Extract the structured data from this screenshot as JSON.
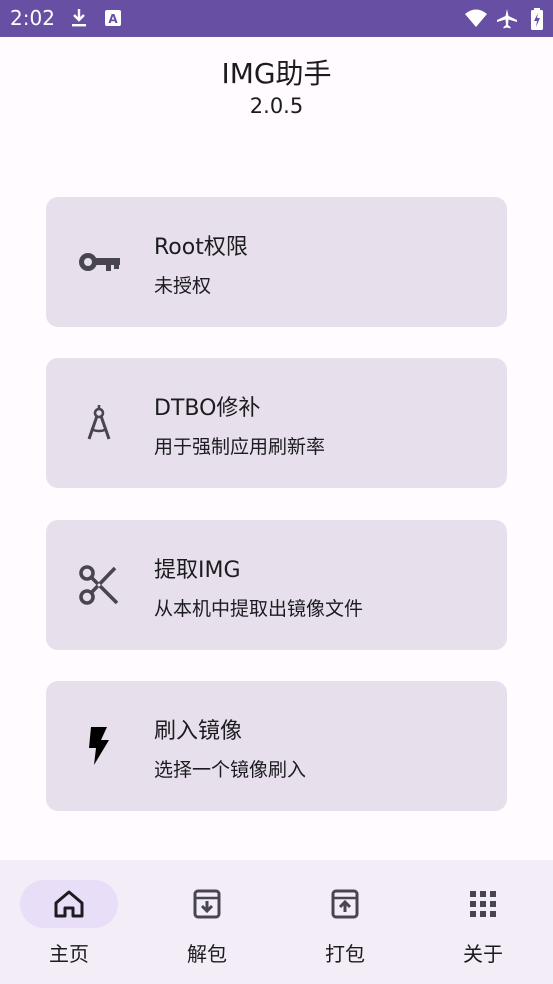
{
  "status_bar": {
    "time": "2:02",
    "icons": [
      "download-icon",
      "text-a-icon",
      "wifi-icon",
      "airplane-icon",
      "battery-icon"
    ]
  },
  "header": {
    "title": "IMG助手",
    "version": "2.0.5"
  },
  "cards": [
    {
      "title": "Root权限",
      "subtitle": "未授权",
      "icon": "key-icon"
    },
    {
      "title": "DTBO修补",
      "subtitle": "用于强制应用刷新率",
      "icon": "compass-icon"
    },
    {
      "title": "提取IMG",
      "subtitle": "从本机中提取出镜像文件",
      "icon": "scissors-icon"
    },
    {
      "title": "刷入镜像",
      "subtitle": "选择一个镜像刷入",
      "icon": "flash-icon"
    }
  ],
  "bottom_nav": {
    "items": [
      {
        "label": "主页",
        "icon": "home-icon",
        "active": true
      },
      {
        "label": "解包",
        "icon": "archive-down-icon",
        "active": false
      },
      {
        "label": "打包",
        "icon": "archive-up-icon",
        "active": false
      },
      {
        "label": "关于",
        "icon": "apps-grid-icon",
        "active": false
      }
    ]
  },
  "colors": {
    "status_bar": "#6750A4",
    "background": "#FFFBFE",
    "card": "#E7E0EC",
    "nav_bar": "#F3EDF7",
    "nav_active_pill": "#E8DEF8",
    "text": "#1C1B1F"
  }
}
